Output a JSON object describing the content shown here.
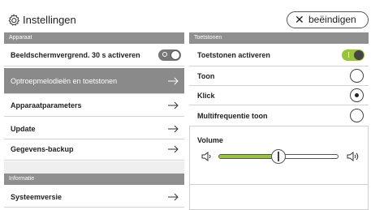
{
  "header": {
    "title": "Instellingen",
    "end_button": {
      "icon": "close-icon",
      "label": "beëindigen"
    }
  },
  "left": {
    "section_device": "Apparaat",
    "screen_lock": {
      "label": "Beeldschermvergrend. 30 s activeren",
      "enabled": false
    },
    "items": [
      {
        "label": "Optroepmelodieën en toetstonen",
        "selected": true
      },
      {
        "label": "Apparaatparameters",
        "selected": false
      },
      {
        "label": "Update",
        "selected": false
      },
      {
        "label": "Gegevens-backup",
        "selected": false
      }
    ],
    "section_info": "Informatie",
    "system_version": "Systeemversie"
  },
  "right": {
    "section": "Toetstonen",
    "activate": {
      "label": "Toetstonen activeren",
      "enabled": true
    },
    "options": [
      {
        "label": "Toon",
        "checked": false
      },
      {
        "label": "Klick",
        "checked": true
      },
      {
        "label": "Multifrequentie toon",
        "checked": false
      }
    ],
    "volume": {
      "label": "Volume",
      "level": 0.5
    }
  },
  "colors": {
    "accent_green": "#98c33b",
    "section_gray": "#8f8f8f",
    "selected_gray": "#8a8a8a"
  }
}
